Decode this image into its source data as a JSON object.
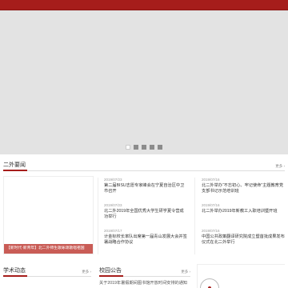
{
  "banner": {
    "slides": 5,
    "active_index": 0
  },
  "news": {
    "title": "二外要闻",
    "more": "更多 ›",
    "feature_caption": "【新时代·新青年】北二外师生歌咏颂歌唱祖国",
    "left_items": [
      {
        "date": "2019/07/23",
        "title": "第二届BISU志愿专家峰会在宁夏自治区中卫市召开"
      },
      {
        "date": "2019/07/23",
        "title": "北二外2019年全国优秀大学生研学夏令营成功举行"
      },
      {
        "date": "2019/07/17",
        "title": "计金标校长率队出席第一届青山发展大会并签署战略合作协议"
      }
    ],
    "right_items": [
      {
        "date": "2019/07/16",
        "title": "北二外举办“不忘初心、牢记使命”主题教育党支部书记示范培训班"
      },
      {
        "date": "2019/07/16",
        "title": "北二外举办2019年新教工入职培训暨开班"
      },
      {
        "date": "2019/07/16",
        "title": "中国公共政策翻译研究院成立暨首批成果发布仪式在北二外举行"
      }
    ]
  },
  "academic": {
    "title": "学术动态",
    "more": "更多 ›"
  },
  "notice": {
    "title": "校园公告",
    "more": "更多 ›",
    "snippet": "关于2019年暑假期间图书馆开放时间安排的通知"
  }
}
